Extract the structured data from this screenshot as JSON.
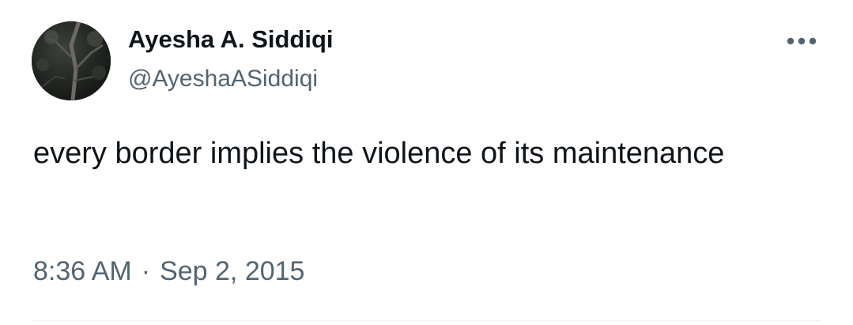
{
  "tweet": {
    "author": {
      "display_name": "Ayesha A. Siddiqi",
      "handle": "@AyeshaASiddiqi",
      "avatar_icon": "profile-photo-trees-night"
    },
    "more_icon": "more-horizontal-icon",
    "text": "every border implies the violence of its maintenance",
    "time": "8:36 AM",
    "separator": "·",
    "date": "Sep 2, 2015"
  },
  "colors": {
    "text_primary": "#0f1419",
    "text_secondary": "#536471",
    "divider": "#eff3f4",
    "background": "#ffffff"
  }
}
